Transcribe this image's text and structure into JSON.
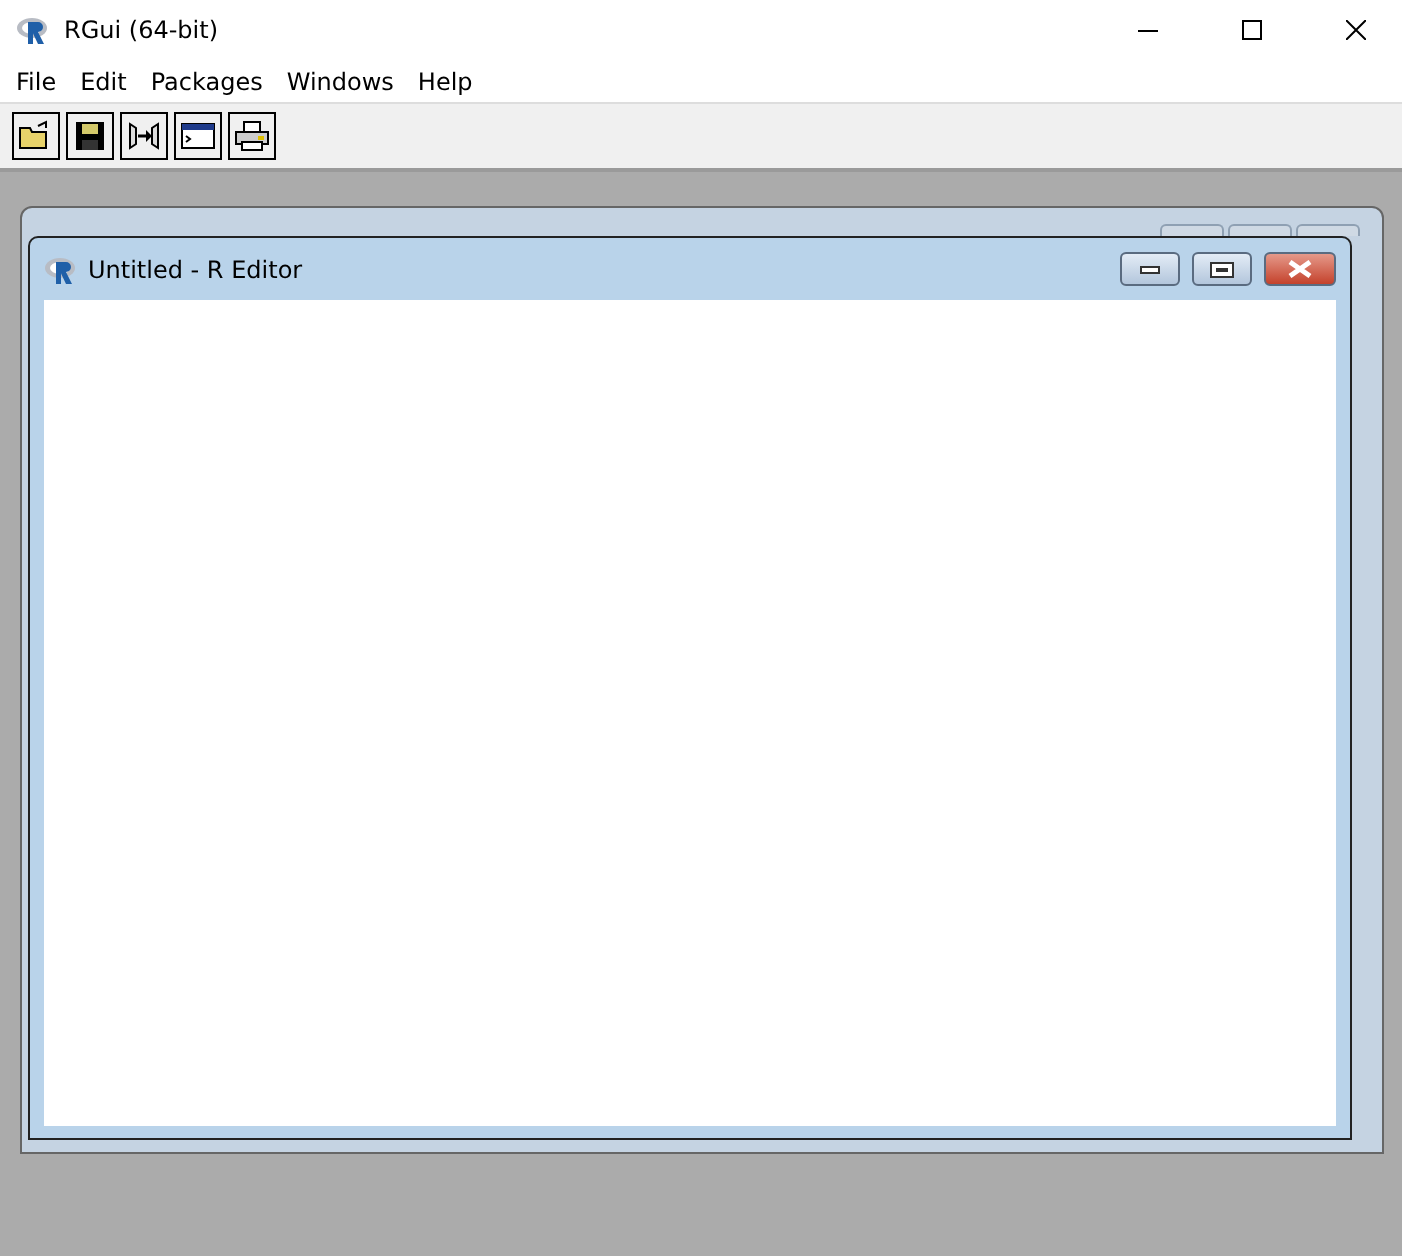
{
  "window": {
    "title": "RGui (64-bit)"
  },
  "menu": [
    "File",
    "Edit",
    "Packages",
    "Windows",
    "Help"
  ],
  "toolbar": [
    {
      "kind": "open"
    },
    {
      "kind": "save"
    },
    {
      "kind": "load"
    },
    {
      "kind": "console"
    },
    {
      "kind": "print"
    }
  ],
  "editor": {
    "title": "Untitled - R Editor"
  }
}
